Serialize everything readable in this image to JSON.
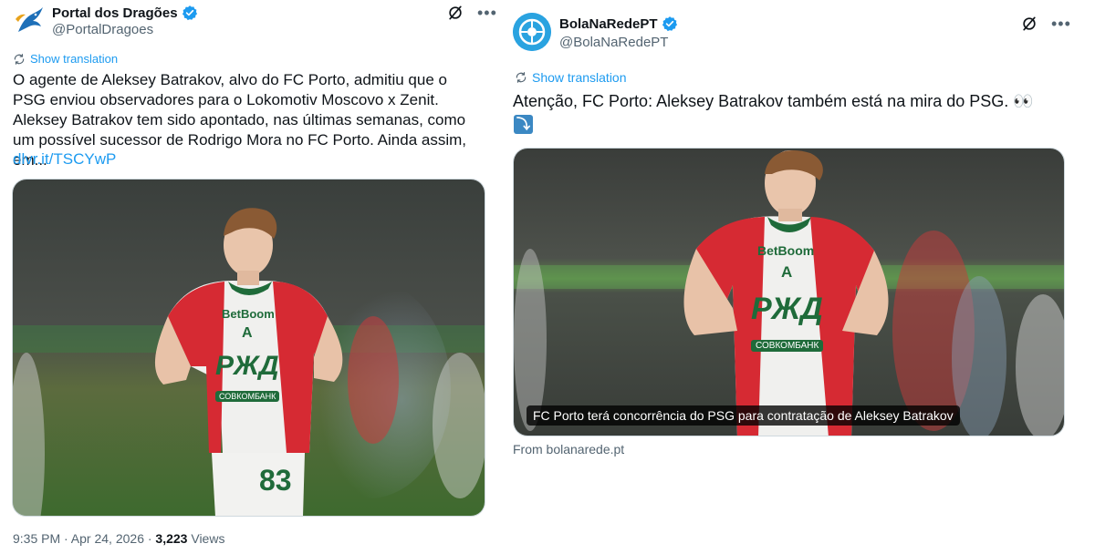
{
  "tweets": [
    {
      "display_name": "Portal dos Dragões",
      "handle": "@PortalDragoes",
      "show_translation": "Show translation",
      "text": "O agente de Aleksey Batrakov, alvo do FC Porto, admitiu que o PSG enviou observadores para o Lokomotiv Moscovo x Zenit. Aleksey Batrakov tem sido apontado, nas últimas semanas, como um possível sucessor de Rodrigo Mora no FC Porto. Ainda assim, em...",
      "link": "dlvr.it/TSCYwP",
      "timestamp": "9:35 PM · Apr 24, 2026 · ",
      "views_count": "3,223",
      "views_label": " Views",
      "jersey": {
        "sponsor_top": "BetBoom",
        "crest_letter": "A",
        "main_logo": "PЖД",
        "bank": "СОВКОМБАНК",
        "number": "83"
      }
    },
    {
      "display_name": "BolaNaRedePT",
      "handle": "@BolaNaRedePT",
      "show_translation": "Show translation",
      "text": "Atenção, FC Porto: Aleksey Batrakov também está na mira do PSG. 👀",
      "text_icon": "⤵",
      "caption": "FC Porto terá concorrência do PSG para contratação de Aleksey Batrakov",
      "from": "From bolanarede.pt",
      "jersey": {
        "sponsor_top": "BetBoom",
        "crest_letter": "A",
        "main_logo": "PЖД",
        "bank": "СОВКОМБАНК"
      }
    }
  ],
  "colors": {
    "verified": "#1d9bf0",
    "link": "#1d9bf0",
    "jersey_red": "#d62a33",
    "jersey_green": "#1f6b3a"
  }
}
